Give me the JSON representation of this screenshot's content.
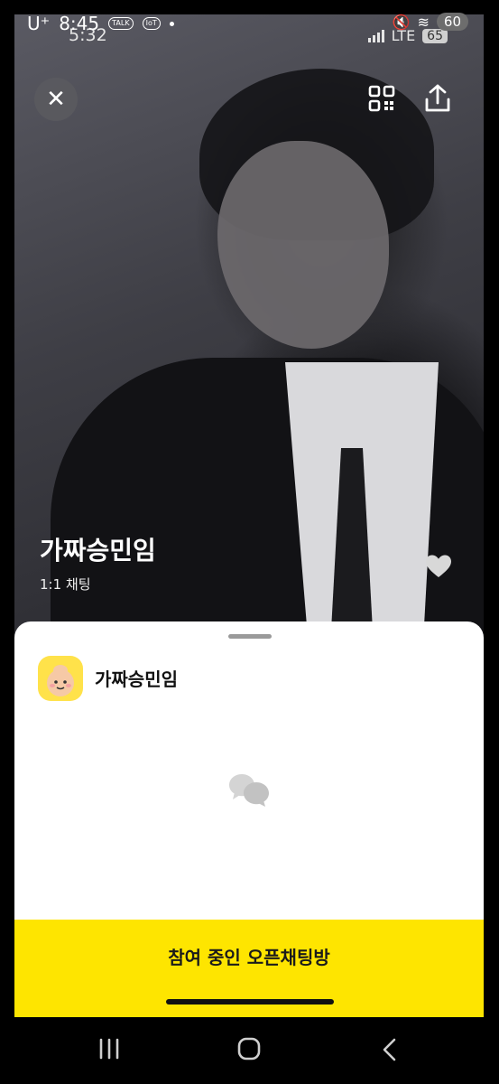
{
  "outer_status": {
    "carrier": "U⁺",
    "time": "8:45",
    "badge_talk": "TALK",
    "badge_iot": "IoT",
    "battery": "60"
  },
  "inner_status": {
    "time": "5:32",
    "network": "LTE",
    "battery": "65"
  },
  "header": {
    "close_glyph": "✕"
  },
  "room": {
    "title": "가짜승민임",
    "type": "1:1 채팅"
  },
  "sheet": {
    "profile_name": "가짜승민임",
    "join_button_label": "참여 중인 오픈채팅방"
  },
  "colors": {
    "accent_yellow": "#FEE500",
    "sheet_bg": "#FFFFFF",
    "close_btn_bg": "#5A5A5F"
  },
  "icons": [
    "close-icon",
    "qr-code-icon",
    "share-icon",
    "heart-icon",
    "chat-bubbles-icon",
    "nav-recent-icon",
    "nav-home-icon",
    "nav-back-icon"
  ]
}
